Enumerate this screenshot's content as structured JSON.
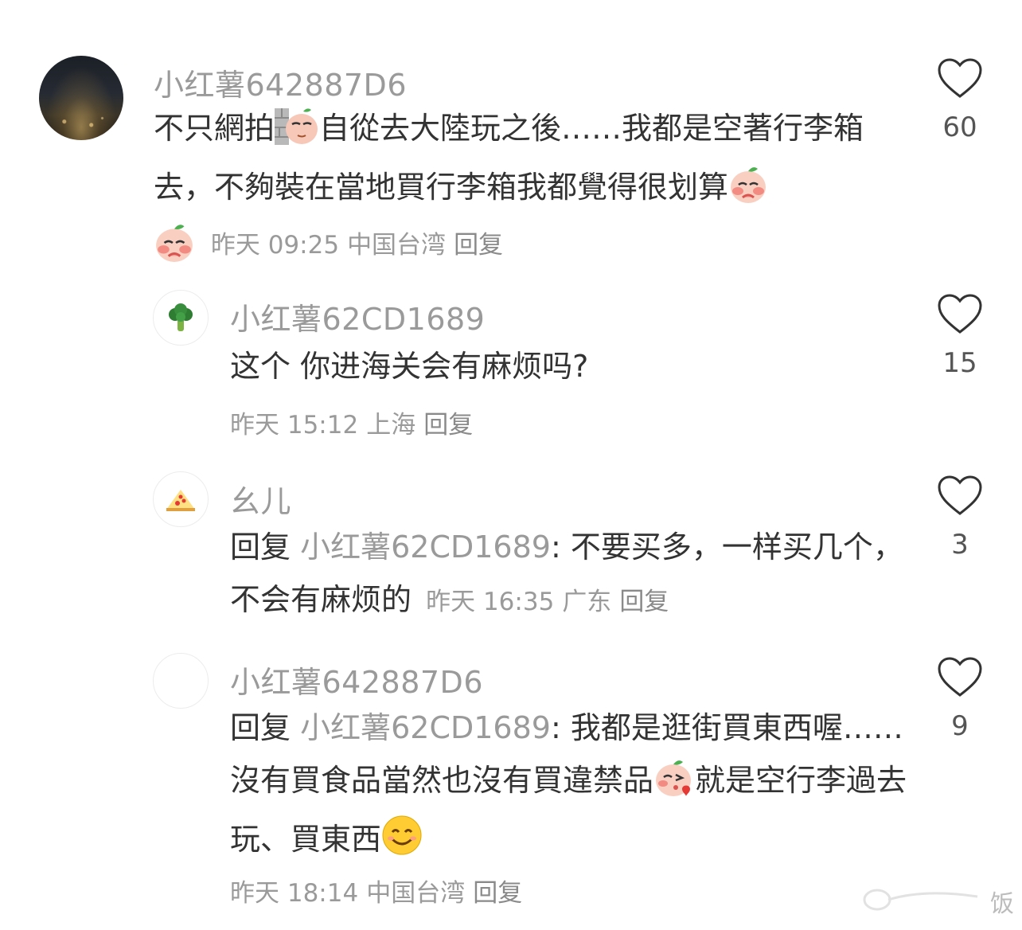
{
  "comments": [
    {
      "username": "小红薯642887D6",
      "text_parts": [
        "不只網拍",
        "自從去大陸玩之後……我都是空著行李箱去，不夠裝在當地買行李箱我都覺得很划算"
      ],
      "time": "昨天 09:25",
      "location": "中国台湾",
      "reply_label": "回复",
      "likes": "60",
      "avatar": "night-city-avatar"
    },
    {
      "username": "小红薯62CD1689",
      "text": "这个 你进海关会有麻烦吗?",
      "time": "昨天 15:12",
      "location": "上海",
      "reply_label": "回复",
      "likes": "15",
      "avatar": "broccoli-icon"
    },
    {
      "username": "幺儿",
      "reply_prefix": "回复",
      "reply_target": "小红薯62CD1689",
      "text_parts": [
        ": 不要买多，一样买几个，不会有麻烦的"
      ],
      "time": "昨天 16:35",
      "location": "广东",
      "reply_label": "回复",
      "likes": "3",
      "avatar": "pizza-icon"
    },
    {
      "username": "小红薯642887D6",
      "reply_prefix": "回复",
      "reply_target": "小红薯62CD1689",
      "text_parts": [
        ": 我都是逛街買東西喔……沒有買食品當然也沒有買違禁品",
        "就是空行李過去玩、買東西"
      ],
      "time": "昨天 18:14",
      "location": "中国台湾",
      "reply_label": "回复",
      "likes": "9",
      "avatar": "night-city-avatar"
    }
  ],
  "watermark": "饭"
}
